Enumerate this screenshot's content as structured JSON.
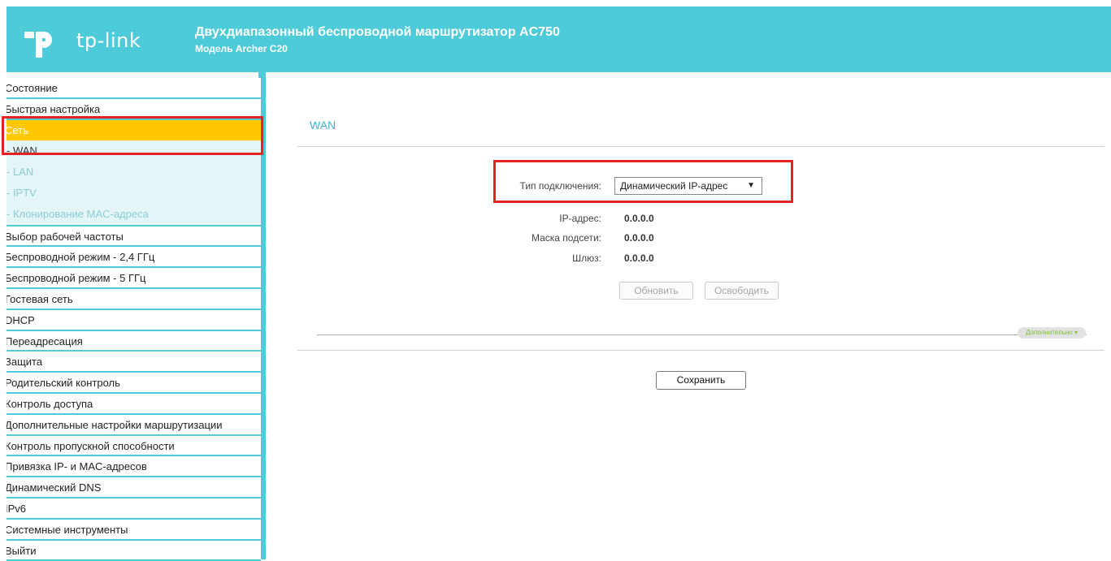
{
  "header": {
    "logo_text": "tp-link",
    "title": "Двухдиапазонный беспроводной маршрутизатор AC750",
    "subtitle": "Модель Archer C20"
  },
  "sidebar": {
    "items_before": [
      "Состояние",
      "Быстрая настройка"
    ],
    "active": "Сеть",
    "subitems": [
      "- WAN",
      "- LAN",
      "- IPTV",
      "- Клонирование MAC-адреса"
    ],
    "items_after": [
      "Выбор рабочей частоты",
      "Беспроводной режим - 2,4 ГГц",
      "Беспроводной режим - 5 ГГц",
      "Гостевая сеть",
      "DHCP",
      "Переадресация",
      "Защита",
      "Родительский контроль",
      "Контроль доступа",
      "Дополнительные настройки маршрутизации",
      "Контроль пропускной способности",
      "Привязка IP- и MAC-адресов",
      "Динамический DNS",
      "IPv6",
      "Системные инструменты",
      "Выйти"
    ]
  },
  "main": {
    "title": "WAN",
    "connection_type_label": "Тип подключения:",
    "connection_type_value": "Динамический IP-адрес",
    "ip_label": "IP-адрес:",
    "ip_value": "0.0.0.0",
    "mask_label": "Маска подсети:",
    "mask_value": "0.0.0.0",
    "gateway_label": "Шлюз:",
    "gateway_value": "0.0.0.0",
    "renew_label": "Обновить",
    "release_label": "Освободить",
    "advanced_label": "Дополнительно",
    "save_label": "Сохранить"
  },
  "colors": {
    "header_bg": "#4ecbd9",
    "active_nav": "#ffc800",
    "highlight_red": "#e32222",
    "title_blue": "#38b9d3"
  }
}
